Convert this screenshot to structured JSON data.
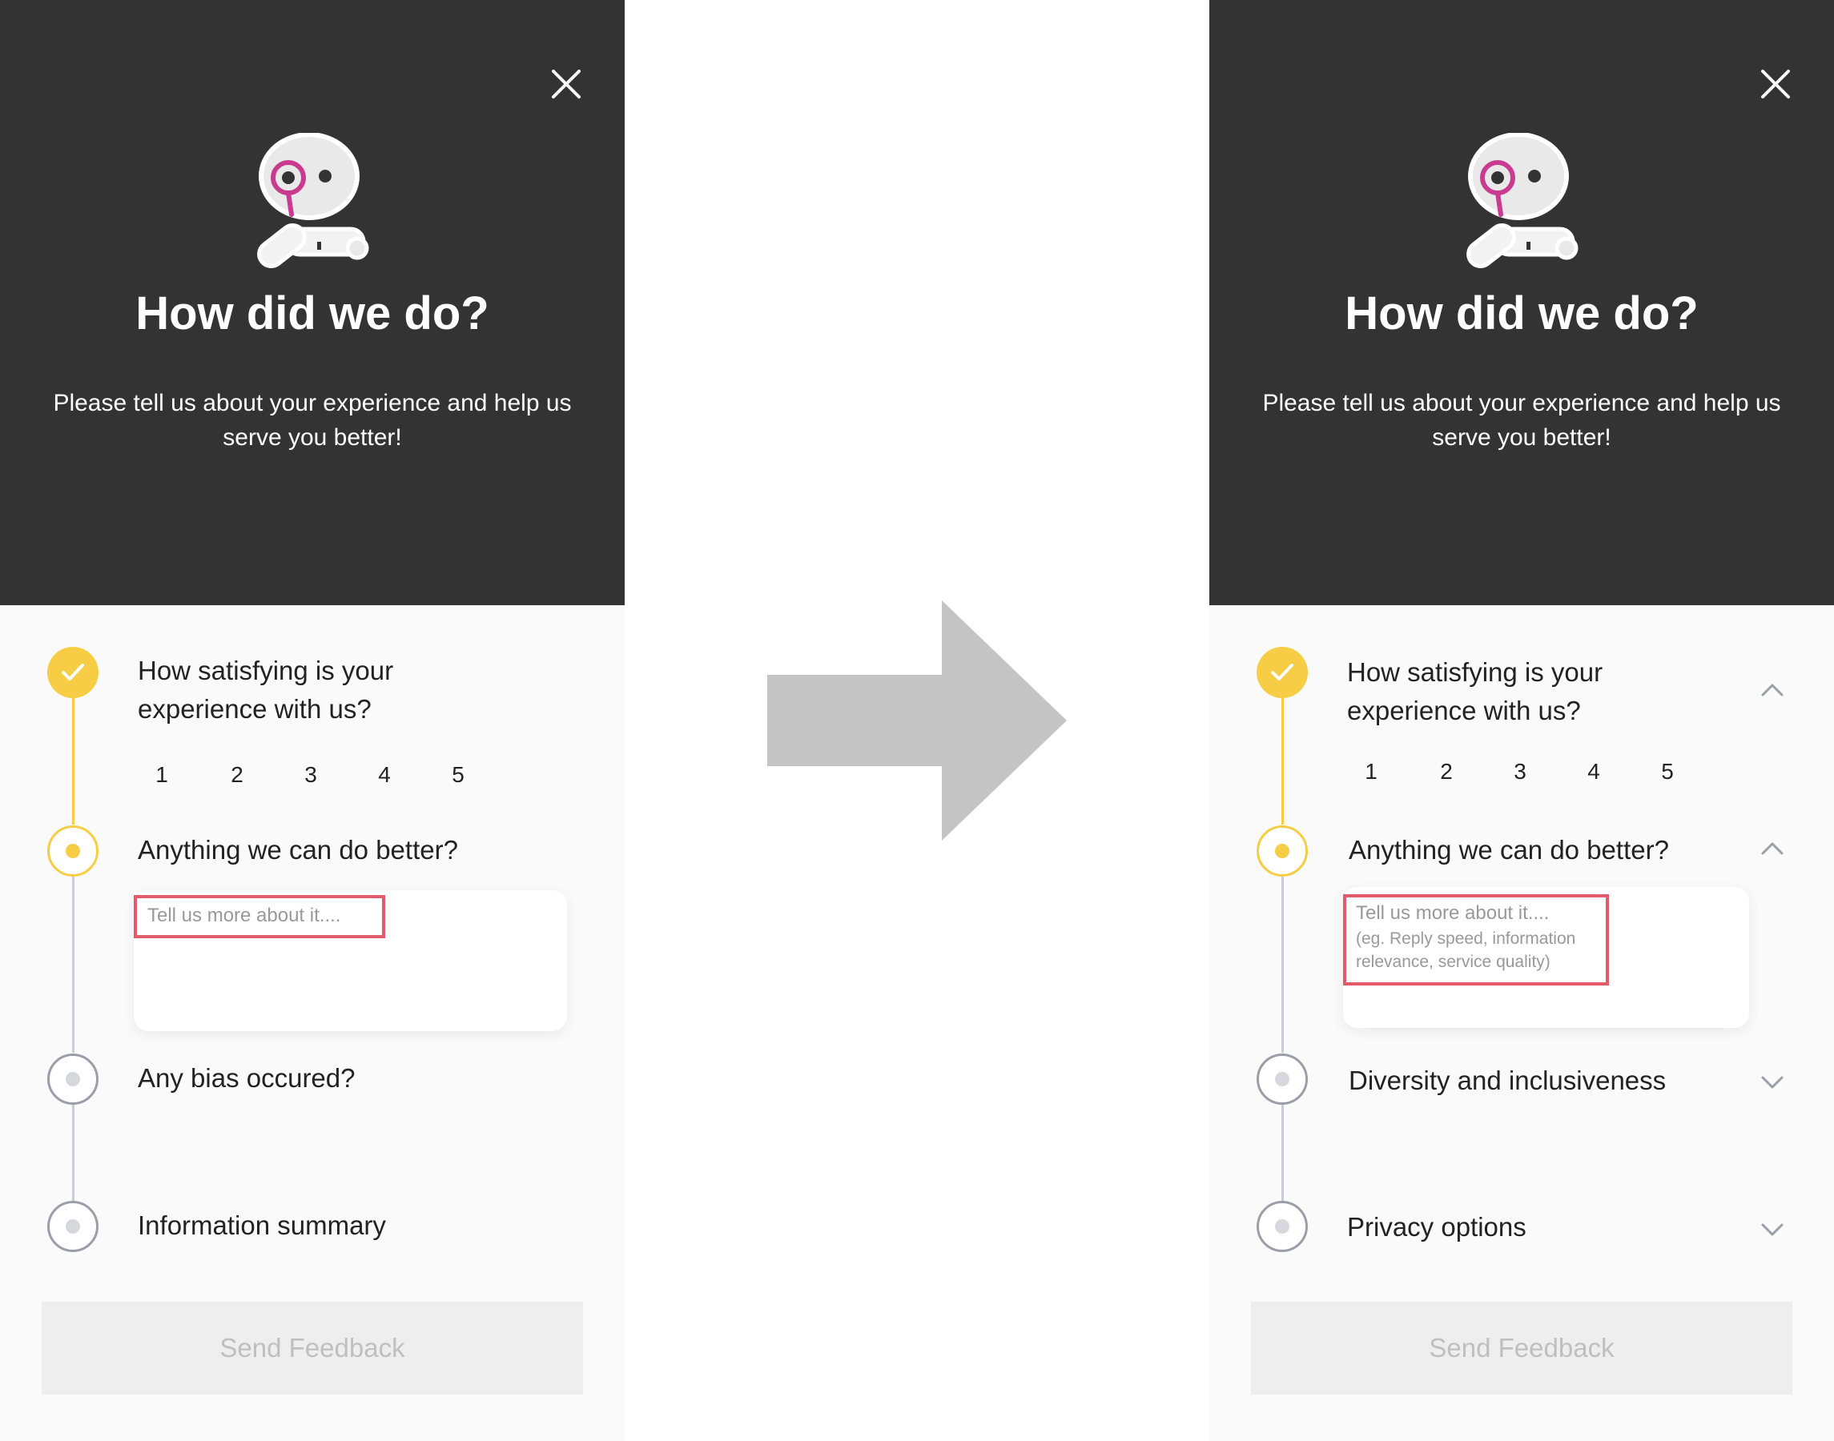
{
  "colors": {
    "header_bg": "#333333",
    "panel_bg": "#fafafa",
    "accent_yellow": "#f7cd45",
    "highlight_red": "#e25b6a",
    "arrow_grey": "#c4c4c4"
  },
  "left": {
    "header": {
      "title": "How did we do?",
      "subtitle": "Please tell us about your experience and help us serve you better!"
    },
    "steps": [
      {
        "label": "How satisfying is your experience with us?",
        "status": "completed"
      },
      {
        "label": "Anything we can do better?",
        "status": "active"
      },
      {
        "label": "Any bias occured?",
        "status": "pending"
      },
      {
        "label": "Information summary",
        "status": "pending"
      }
    ],
    "ratings": [
      "1",
      "2",
      "3",
      "4",
      "5"
    ],
    "textarea": {
      "placeholder": "Tell us more about it...."
    },
    "send_label": "Send Feedback"
  },
  "right": {
    "header": {
      "title": "How did we do?",
      "subtitle": "Please tell us about your experience and help us serve you better!"
    },
    "steps": [
      {
        "label": "How satisfying is your experience with us?",
        "status": "completed",
        "chevron": "chevron-up-icon"
      },
      {
        "label": "Anything we can do better?",
        "status": "active",
        "chevron": "chevron-up-icon"
      },
      {
        "label": "Diversity and inclusiveness",
        "status": "pending",
        "chevron": "chevron-down-icon"
      },
      {
        "label": "Privacy options",
        "status": "pending",
        "chevron": "chevron-down-icon"
      }
    ],
    "ratings": [
      "1",
      "2",
      "3",
      "4",
      "5"
    ],
    "textarea": {
      "placeholder": "Tell us more about it....",
      "hint_line1": "(eg. Reply speed, information",
      "hint_line2": "relevance, service quality)"
    },
    "send_label": "Send Feedback"
  },
  "icons": {
    "close": "close-icon",
    "mascot": "robot-mascot-icon",
    "check": "check-icon",
    "arrow": "right-arrow-icon"
  }
}
